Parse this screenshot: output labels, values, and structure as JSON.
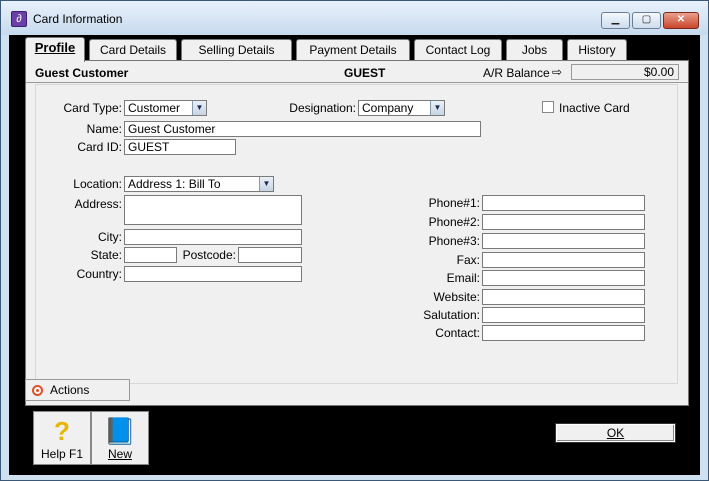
{
  "window": {
    "title": "Card Information",
    "minimize": "▁",
    "maximize": "▢",
    "close": "✕"
  },
  "tabs": [
    "Profile",
    "Card Details",
    "Selling Details",
    "Payment Details",
    "Contact Log",
    "Jobs",
    "History"
  ],
  "header": {
    "customer_name": "Guest Customer",
    "card_id": "GUEST",
    "ar_balance_label": "A/R Balance",
    "ar_arrow": "⇨",
    "ar_balance_value": "$0.00"
  },
  "form": {
    "card_type_label": "Card Type:",
    "card_type_value": "Customer",
    "designation_label": "Designation:",
    "designation_value": "Company",
    "inactive_label": "Inactive Card",
    "name_label": "Name:",
    "name_value": "Guest Customer",
    "card_id_label": "Card ID:",
    "card_id_value": "GUEST",
    "location_label": "Location:",
    "location_value": "Address 1:  Bill To",
    "address_label": "Address:",
    "city_label": "City:",
    "state_label": "State:",
    "postcode_label": "Postcode:",
    "country_label": "Country:",
    "phone1_label": "Phone#1:",
    "phone2_label": "Phone#2:",
    "phone3_label": "Phone#3:",
    "fax_label": "Fax:",
    "email_label": "Email:",
    "website_label": "Website:",
    "salutation_label": "Salutation:",
    "contact_label": "Contact:"
  },
  "buttons": {
    "actions": "Actions",
    "help": "Help F1",
    "new": "New",
    "ok": "OK"
  },
  "icons": {
    "help_icon": "?",
    "new_icon": "📘"
  }
}
